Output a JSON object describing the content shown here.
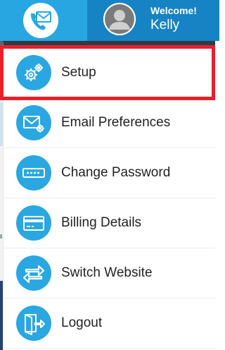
{
  "header": {
    "welcome_label": "Welcome!",
    "user_name": "Kelly",
    "contact_icon": "phone-envelope-icon",
    "avatar_icon": "user-silhouette-icon"
  },
  "menu": {
    "selected_item": "Setup",
    "highlight_color": "#e8202a",
    "icon_color": "#2aa7e1",
    "items": [
      {
        "label": "Setup",
        "icon": "gears-icon"
      },
      {
        "label": "Email Preferences",
        "icon": "envelope-gear-icon"
      },
      {
        "label": "Change Password",
        "icon": "password-field-icon"
      },
      {
        "label": "Billing Details",
        "icon": "credit-card-icon"
      },
      {
        "label": "Switch Website",
        "icon": "swap-arrows-icon"
      },
      {
        "label": "Logout",
        "icon": "door-exit-icon"
      }
    ]
  }
}
